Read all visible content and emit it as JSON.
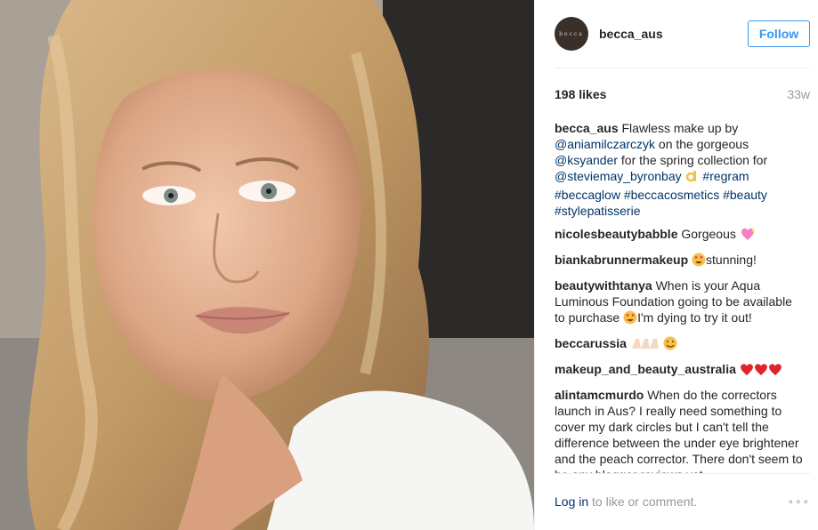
{
  "post": {
    "username": "becca_aus",
    "avatar_text": "becca",
    "follow_label": "Follow",
    "likes": "198 likes",
    "time_ago": "33w"
  },
  "caption": {
    "user": "becca_aus",
    "t1": " Flawless make up by ",
    "m1": "@aniamilczarczyk",
    "t2": " on the gorgeous ",
    "m2": "@ksyander",
    "t3": " for the spring collection for ",
    "m3": "@steviemay_byronbay",
    "t4": " ",
    "h1": "#regram",
    "h2": "#beccaglow",
    "h3": "#beccacosmetics",
    "h4": "#beauty",
    "h5": "#stylepatisserie"
  },
  "comments": [
    {
      "user": "nicolesbeautybabble",
      "text": " Gorgeous ",
      "emoji": "heart-sparkle"
    },
    {
      "user": "biankabrunnermakeup",
      "text": "stunning!",
      "emoji": "heart-eyes"
    },
    {
      "user": "beautywithtanya",
      "text1": " When is your Aqua Luminous Foundation going to be available to purchase ",
      "text2": "I'm dying to try it out!"
    },
    {
      "user": "beccarussia",
      "emoji": "clap-smile"
    },
    {
      "user": "makeup_and_beauty_australia",
      "emoji": "three-hearts"
    },
    {
      "user": "alintamcmurdo",
      "text": " When do the correctors launch in Aus? I really need something to cover my dark circles but I can't tell the difference between the under eye brightener and the peach corrector. There don't seem to be any blogger reviews yet."
    }
  ],
  "footer": {
    "login": "Log in",
    "prompt": " to like or comment.",
    "more": "∘∘∘"
  },
  "colors": {
    "accent": "#3897f0",
    "link": "#003569",
    "muted": "#999999"
  }
}
